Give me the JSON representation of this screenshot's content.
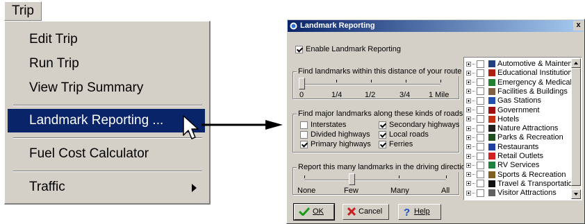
{
  "menu": {
    "title": "Trip",
    "items": [
      {
        "label": "Edit Trip"
      },
      {
        "label": "Run Trip"
      },
      {
        "label": "View Trip Summary"
      },
      {
        "label": "Landmark Reporting ..."
      },
      {
        "label": "Fuel Cost Calculator"
      },
      {
        "label": "Traffic"
      }
    ]
  },
  "dialog": {
    "title": "Landmark Reporting",
    "close": "x",
    "enable_label": "Enable Landmark Reporting",
    "distance": {
      "label": "Find landmarks within this distance of your route",
      "scale": [
        "0",
        "1/4",
        "1/2",
        "3/4",
        "1 Mile"
      ],
      "selected_fraction": 0
    },
    "roads": {
      "label": "Find major landmarks along these kinds of roads",
      "options": [
        {
          "label": "Interstates",
          "checked": false
        },
        {
          "label": "Secondary highways",
          "checked": true
        },
        {
          "label": "Divided highways",
          "checked": false
        },
        {
          "label": "Local roads",
          "checked": true
        },
        {
          "label": "Primary highways",
          "checked": true
        },
        {
          "label": "Ferries",
          "checked": true
        }
      ]
    },
    "count": {
      "label": "Report this many landmarks in the driving directions",
      "scale": [
        "None",
        "Few",
        "Many",
        "All"
      ],
      "selected_fraction": 0.33
    },
    "categories": [
      {
        "label": "Automotive & Maintenance",
        "icon": "car-icon",
        "color": "#204080"
      },
      {
        "label": "Educational Institutions",
        "icon": "school-icon",
        "color": "#b02010"
      },
      {
        "label": "Emergency & Medical",
        "icon": "medical-icon",
        "color": "#208030"
      },
      {
        "label": "Facilities & Buildings",
        "icon": "building-icon",
        "color": "#806040"
      },
      {
        "label": "Gas Stations",
        "icon": "gas-pump-icon",
        "color": "#2050b0"
      },
      {
        "label": "Government",
        "icon": "government-icon",
        "color": "#a01010"
      },
      {
        "label": "Hotels",
        "icon": "hotel-icon",
        "color": "#c03010"
      },
      {
        "label": "Nature Attractions",
        "icon": "nature-icon",
        "color": "#202020"
      },
      {
        "label": "Parks & Recreation",
        "icon": "park-icon",
        "color": "#205020"
      },
      {
        "label": "Restaurants",
        "icon": "restaurant-icon",
        "color": "#2040a0"
      },
      {
        "label": "Retail Outlets",
        "icon": "retail-icon",
        "color": "#d02020"
      },
      {
        "label": "RV Services",
        "icon": "rv-icon",
        "color": "#208040"
      },
      {
        "label": "Sports & Recreation",
        "icon": "sports-icon",
        "color": "#806020"
      },
      {
        "label": "Travel & Transportation",
        "icon": "airplane-icon",
        "color": "#101010"
      },
      {
        "label": "Visitor Attractions",
        "icon": "visitor-icon",
        "color": "#606060"
      }
    ],
    "buttons": {
      "ok": "OK",
      "cancel": "Cancel",
      "help": "Help"
    }
  }
}
